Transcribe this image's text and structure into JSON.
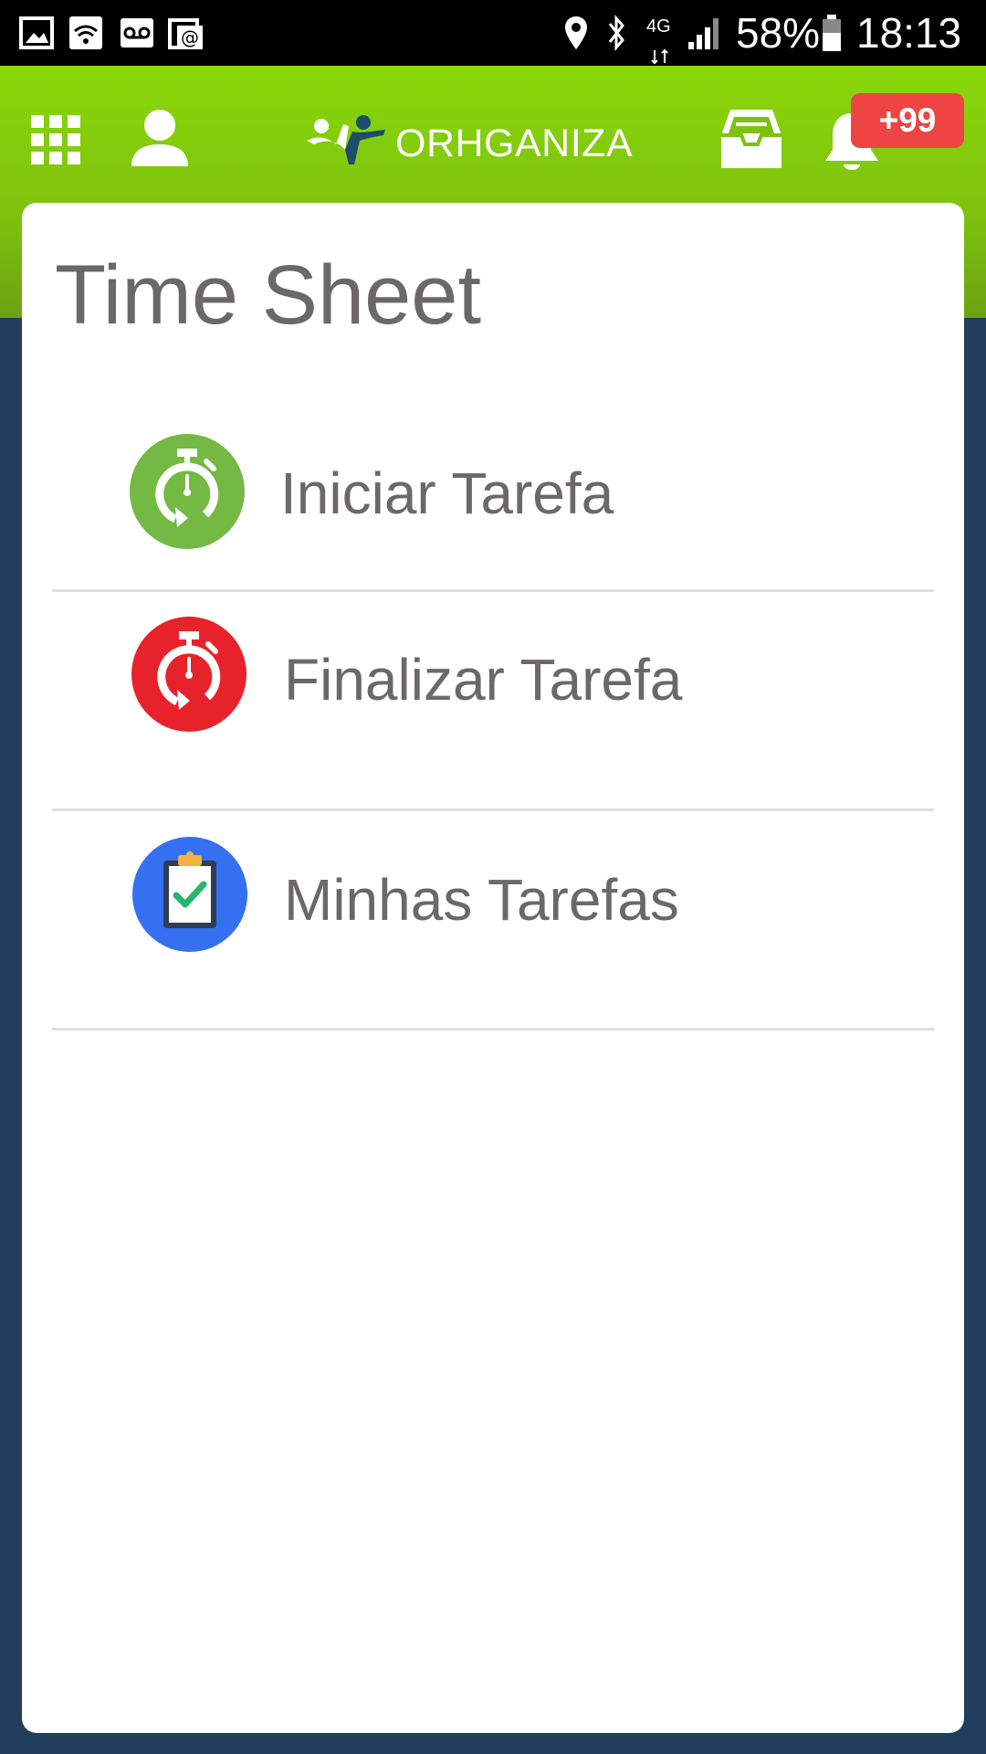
{
  "status_bar": {
    "battery": "58%",
    "time": "18:13",
    "network": "4G",
    "icons": [
      "gallery-icon",
      "wifi-icon",
      "voicemail-icon",
      "email-icon",
      "location-icon",
      "bluetooth-icon",
      "signal-icon",
      "battery-icon"
    ]
  },
  "header": {
    "logo_text": "ORHGANIZA",
    "notification_badge": "+99",
    "icons": [
      "apps-grid-icon",
      "user-icon",
      "logo-figure-icon",
      "inbox-icon",
      "bell-icon"
    ]
  },
  "page": {
    "title": "Time Sheet"
  },
  "menu": {
    "items": [
      {
        "label": "Iniciar Tarefa",
        "icon": "stopwatch-start-icon",
        "color": "#74b944"
      },
      {
        "label": "Finalizar Tarefa",
        "icon": "stopwatch-stop-icon",
        "color": "#e8222b"
      },
      {
        "label": "Minhas Tarefas",
        "icon": "clipboard-check-icon",
        "color": "#3470f0"
      }
    ]
  },
  "colors": {
    "header_green": "#7dc20e",
    "background_navy": "#213e5c",
    "badge_red": "#ef4444",
    "text_gray": "#6b6869"
  }
}
